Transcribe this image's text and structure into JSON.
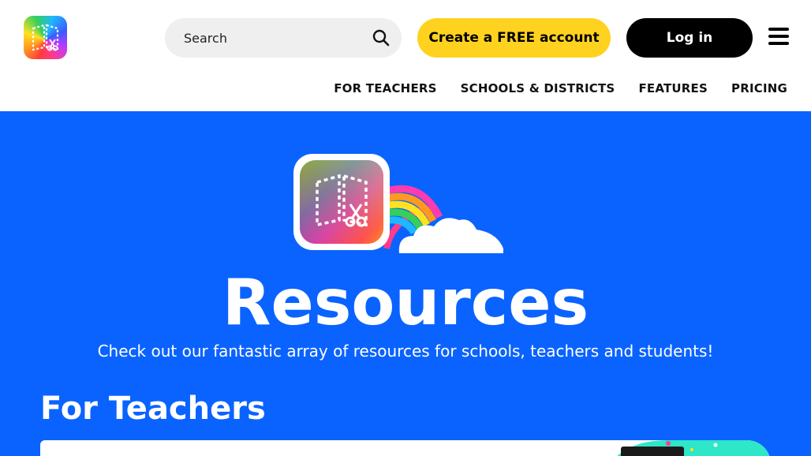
{
  "header": {
    "logo_icon": "book-creator-logo-icon",
    "search": {
      "placeholder": "Search",
      "icon": "search-icon"
    },
    "create_account_label": "Create a FREE account",
    "login_label": "Log in",
    "menu_icon": "hamburger-menu-icon",
    "nav": [
      {
        "label": "FOR TEACHERS"
      },
      {
        "label": "SCHOOLS & DISTRICTS"
      },
      {
        "label": "FEATURES"
      },
      {
        "label": "PRICING"
      }
    ]
  },
  "hero": {
    "illustration": "book-creator-rainbow-cloud-illustration",
    "title": "Resources",
    "subtitle": "Check out our fantastic array of resources for schools, teachers and students!",
    "section_title": "For Teachers"
  },
  "colors": {
    "hero_bg": "#0a63ff",
    "create_button": "#ffd21f",
    "login_button": "#000000",
    "search_bg": "#efefef"
  }
}
